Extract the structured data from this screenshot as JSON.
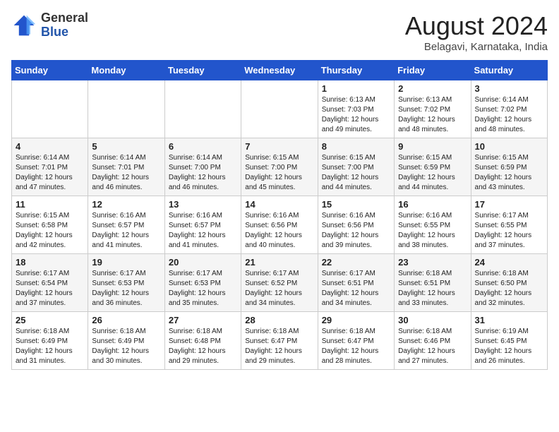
{
  "logo": {
    "general": "General",
    "blue": "Blue"
  },
  "header": {
    "month_title": "August 2024",
    "location": "Belagavi, Karnataka, India"
  },
  "days_of_week": [
    "Sunday",
    "Monday",
    "Tuesday",
    "Wednesday",
    "Thursday",
    "Friday",
    "Saturday"
  ],
  "weeks": [
    [
      {
        "day": "",
        "info": ""
      },
      {
        "day": "",
        "info": ""
      },
      {
        "day": "",
        "info": ""
      },
      {
        "day": "",
        "info": ""
      },
      {
        "day": "1",
        "info": "Sunrise: 6:13 AM\nSunset: 7:03 PM\nDaylight: 12 hours\nand 49 minutes."
      },
      {
        "day": "2",
        "info": "Sunrise: 6:13 AM\nSunset: 7:02 PM\nDaylight: 12 hours\nand 48 minutes."
      },
      {
        "day": "3",
        "info": "Sunrise: 6:14 AM\nSunset: 7:02 PM\nDaylight: 12 hours\nand 48 minutes."
      }
    ],
    [
      {
        "day": "4",
        "info": "Sunrise: 6:14 AM\nSunset: 7:01 PM\nDaylight: 12 hours\nand 47 minutes."
      },
      {
        "day": "5",
        "info": "Sunrise: 6:14 AM\nSunset: 7:01 PM\nDaylight: 12 hours\nand 46 minutes."
      },
      {
        "day": "6",
        "info": "Sunrise: 6:14 AM\nSunset: 7:00 PM\nDaylight: 12 hours\nand 46 minutes."
      },
      {
        "day": "7",
        "info": "Sunrise: 6:15 AM\nSunset: 7:00 PM\nDaylight: 12 hours\nand 45 minutes."
      },
      {
        "day": "8",
        "info": "Sunrise: 6:15 AM\nSunset: 7:00 PM\nDaylight: 12 hours\nand 44 minutes."
      },
      {
        "day": "9",
        "info": "Sunrise: 6:15 AM\nSunset: 6:59 PM\nDaylight: 12 hours\nand 44 minutes."
      },
      {
        "day": "10",
        "info": "Sunrise: 6:15 AM\nSunset: 6:59 PM\nDaylight: 12 hours\nand 43 minutes."
      }
    ],
    [
      {
        "day": "11",
        "info": "Sunrise: 6:15 AM\nSunset: 6:58 PM\nDaylight: 12 hours\nand 42 minutes."
      },
      {
        "day": "12",
        "info": "Sunrise: 6:16 AM\nSunset: 6:57 PM\nDaylight: 12 hours\nand 41 minutes."
      },
      {
        "day": "13",
        "info": "Sunrise: 6:16 AM\nSunset: 6:57 PM\nDaylight: 12 hours\nand 41 minutes."
      },
      {
        "day": "14",
        "info": "Sunrise: 6:16 AM\nSunset: 6:56 PM\nDaylight: 12 hours\nand 40 minutes."
      },
      {
        "day": "15",
        "info": "Sunrise: 6:16 AM\nSunset: 6:56 PM\nDaylight: 12 hours\nand 39 minutes."
      },
      {
        "day": "16",
        "info": "Sunrise: 6:16 AM\nSunset: 6:55 PM\nDaylight: 12 hours\nand 38 minutes."
      },
      {
        "day": "17",
        "info": "Sunrise: 6:17 AM\nSunset: 6:55 PM\nDaylight: 12 hours\nand 37 minutes."
      }
    ],
    [
      {
        "day": "18",
        "info": "Sunrise: 6:17 AM\nSunset: 6:54 PM\nDaylight: 12 hours\nand 37 minutes."
      },
      {
        "day": "19",
        "info": "Sunrise: 6:17 AM\nSunset: 6:53 PM\nDaylight: 12 hours\nand 36 minutes."
      },
      {
        "day": "20",
        "info": "Sunrise: 6:17 AM\nSunset: 6:53 PM\nDaylight: 12 hours\nand 35 minutes."
      },
      {
        "day": "21",
        "info": "Sunrise: 6:17 AM\nSunset: 6:52 PM\nDaylight: 12 hours\nand 34 minutes."
      },
      {
        "day": "22",
        "info": "Sunrise: 6:17 AM\nSunset: 6:51 PM\nDaylight: 12 hours\nand 34 minutes."
      },
      {
        "day": "23",
        "info": "Sunrise: 6:18 AM\nSunset: 6:51 PM\nDaylight: 12 hours\nand 33 minutes."
      },
      {
        "day": "24",
        "info": "Sunrise: 6:18 AM\nSunset: 6:50 PM\nDaylight: 12 hours\nand 32 minutes."
      }
    ],
    [
      {
        "day": "25",
        "info": "Sunrise: 6:18 AM\nSunset: 6:49 PM\nDaylight: 12 hours\nand 31 minutes."
      },
      {
        "day": "26",
        "info": "Sunrise: 6:18 AM\nSunset: 6:49 PM\nDaylight: 12 hours\nand 30 minutes."
      },
      {
        "day": "27",
        "info": "Sunrise: 6:18 AM\nSunset: 6:48 PM\nDaylight: 12 hours\nand 29 minutes."
      },
      {
        "day": "28",
        "info": "Sunrise: 6:18 AM\nSunset: 6:47 PM\nDaylight: 12 hours\nand 29 minutes."
      },
      {
        "day": "29",
        "info": "Sunrise: 6:18 AM\nSunset: 6:47 PM\nDaylight: 12 hours\nand 28 minutes."
      },
      {
        "day": "30",
        "info": "Sunrise: 6:18 AM\nSunset: 6:46 PM\nDaylight: 12 hours\nand 27 minutes."
      },
      {
        "day": "31",
        "info": "Sunrise: 6:19 AM\nSunset: 6:45 PM\nDaylight: 12 hours\nand 26 minutes."
      }
    ]
  ]
}
